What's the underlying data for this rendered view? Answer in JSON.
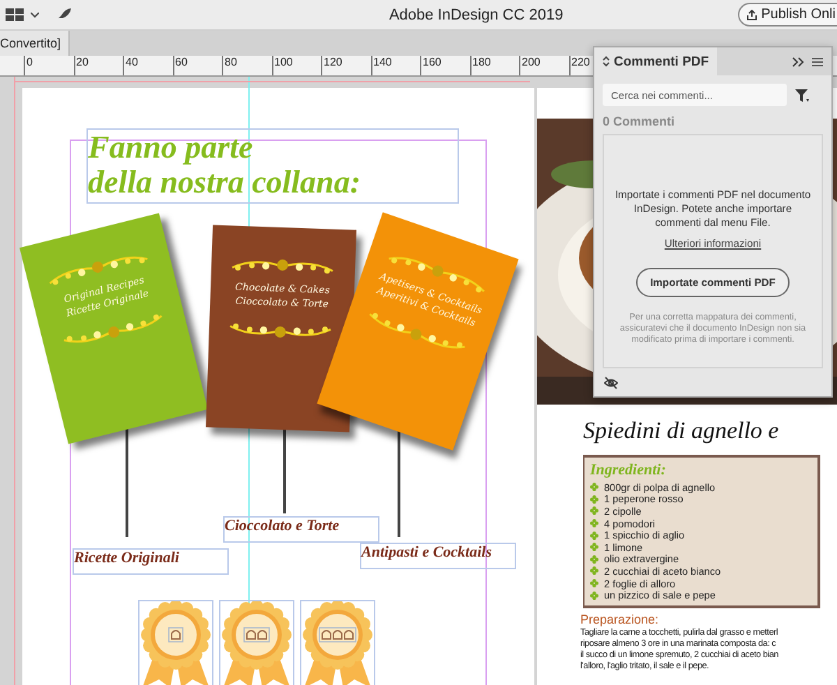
{
  "app_bar": {
    "title": "Adobe InDesign CC 2019",
    "publish_button": "Publish Onli"
  },
  "document_tab": {
    "label": "Convertito]"
  },
  "ruler": {
    "ticks": [
      "0",
      "20",
      "40",
      "60",
      "80",
      "100",
      "120",
      "140",
      "160",
      "180",
      "200",
      "220"
    ]
  },
  "left_page": {
    "headline": [
      "Fanno parte",
      "della nostra collana:"
    ],
    "covers": [
      {
        "color": "#8fbe22",
        "lines": [
          "Original Recipes",
          "Ricette Originale"
        ],
        "caption": "Ricette Originali"
      },
      {
        "color": "#8a4424",
        "lines": [
          "Chocolate & Cakes",
          "Cioccolato & Torte"
        ],
        "caption": "Cioccolato e Torte"
      },
      {
        "color": "#f39208",
        "lines": [
          "Apetisers & Cocktails",
          "Aperitivi & Cocktails"
        ],
        "caption": "Antipasti e Cocktails"
      }
    ],
    "badges": [
      {
        "kind": "single"
      },
      {
        "kind": "double"
      },
      {
        "kind": "triple"
      }
    ]
  },
  "right_page": {
    "recipe_title": "Spiedini di agnello e",
    "ingredients_heading": "Ingredienti:",
    "ingredients": [
      "800gr di polpa di agnello",
      "1 peperone rosso",
      "2 cipolle",
      "4 pomodori",
      "1 spicchio di aglio",
      "1 limone",
      "olio extravergine",
      "2 cucchiai di aceto bianco",
      "2 foglie di alloro",
      "un pizzico di sale e pepe"
    ],
    "preparation_heading": "Preparazione:",
    "preparation_lines": [
      "Tagliare la carne a tocchetti, pulirla dal grasso e metterl",
      "riposare almeno 3 ore in una marinata composta da:  c",
      "il succo di un limone spremuto, 2 cucchiai di aceto bian",
      "l'alloro, l'aglio tritato, il sale e il pepe."
    ]
  },
  "comments_panel": {
    "title": "Commenti PDF",
    "search": {
      "placeholder": "Cerca nei commenti..."
    },
    "count": "0 Commenti",
    "message": "Importate i commenti PDF nel documento InDesign. Potete anche importare commenti dal menu File.",
    "link": "Ulteriori informazioni",
    "button": "Importate commenti PDF",
    "note": "Per una corretta mappatura dei commenti, assicuratevi che il documento InDesign non sia modificato prima di importare i commenti."
  }
}
